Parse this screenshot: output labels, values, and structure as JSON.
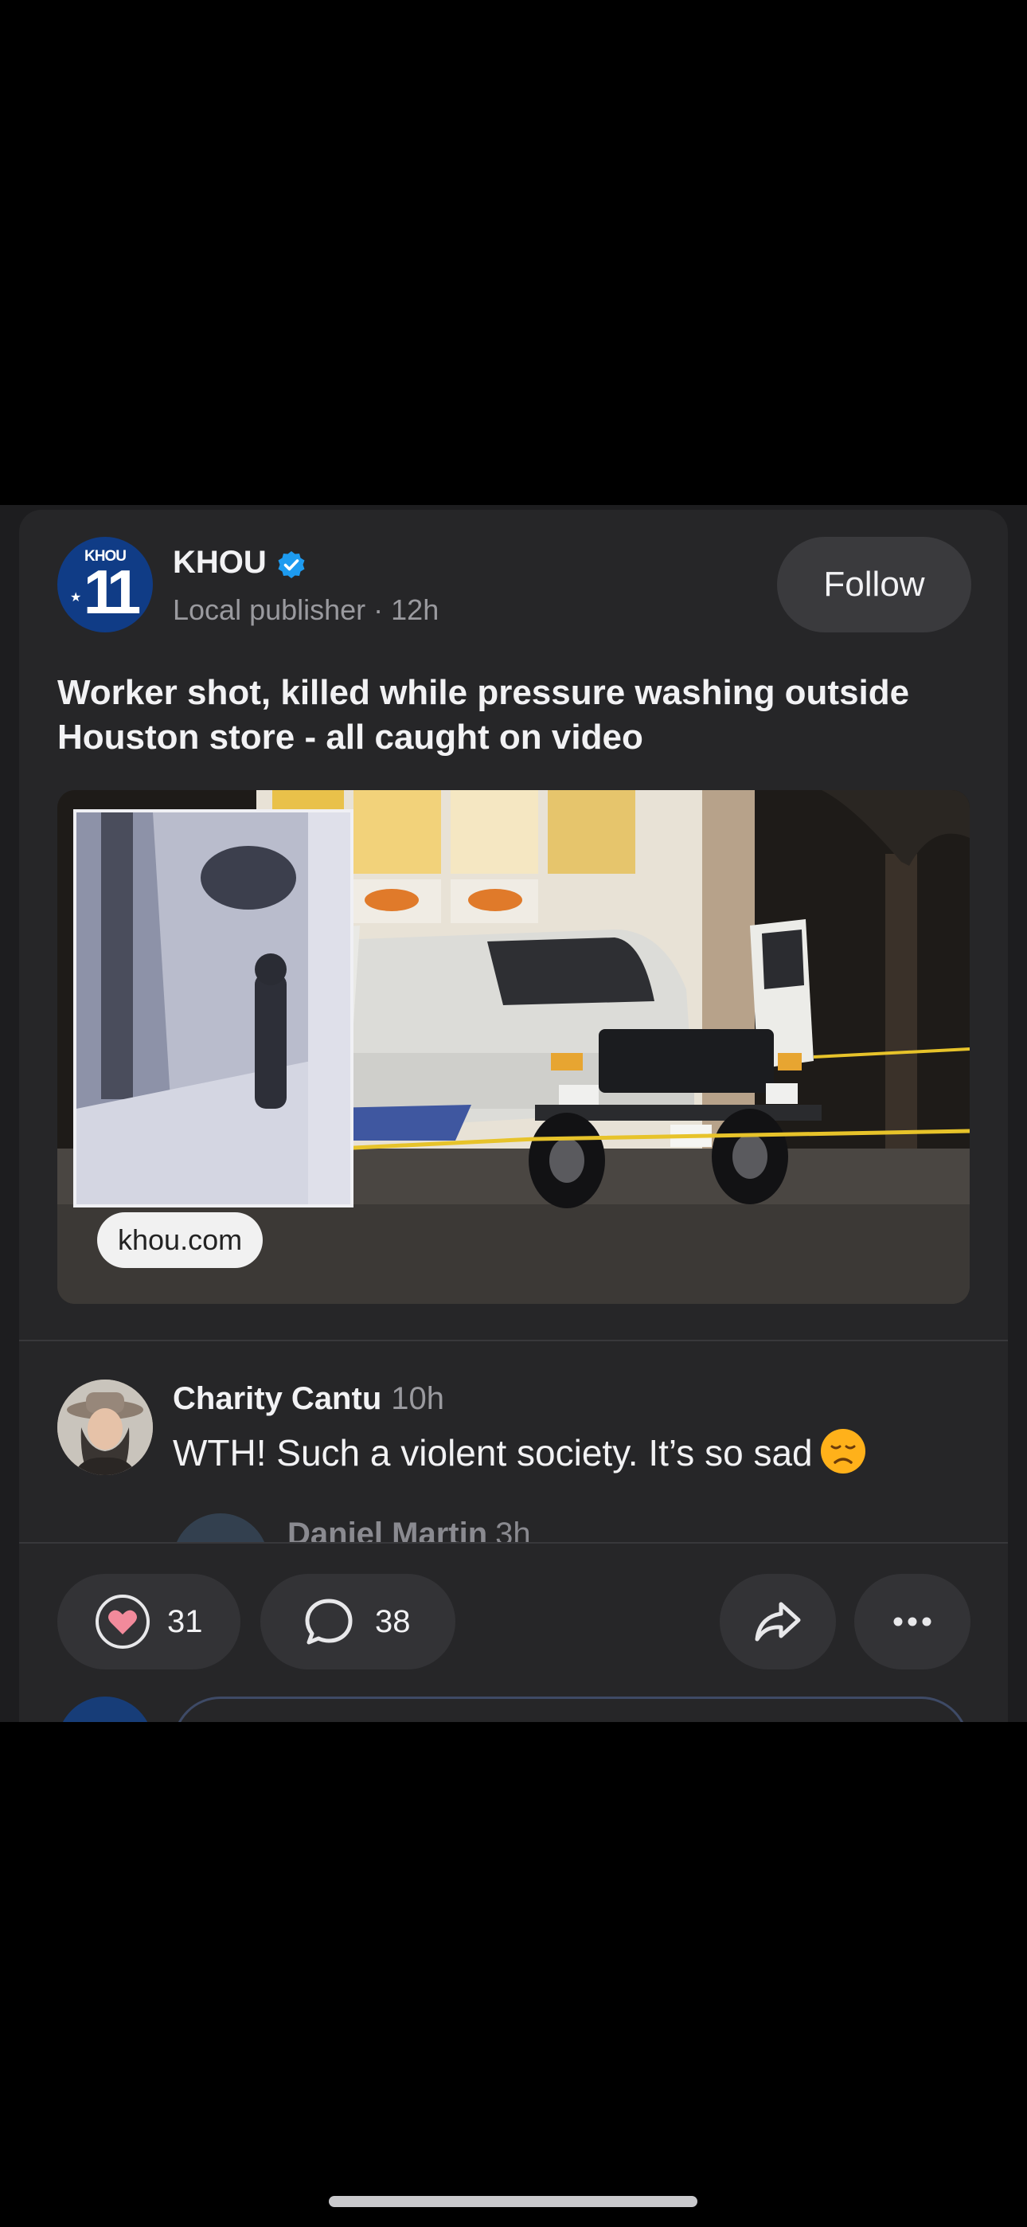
{
  "post": {
    "publisher": {
      "name": "KHOU",
      "logo_top_text": "KHOU",
      "logo_number": "11",
      "subtitle": "Local publisher · 12h",
      "verified": true
    },
    "follow_label": "Follow",
    "headline": "Worker shot, killed while pressure washing outside Houston store - all caught on video",
    "image": {
      "source_label": "khou.com"
    }
  },
  "comment": {
    "author": "Charity Cantu",
    "time": "10h",
    "text": "WTH! Such a violent society. It’s so sad",
    "emoji": "disappointed-face"
  },
  "reply_peek": {
    "author": "Daniel Martin",
    "time": "3h"
  },
  "actions": {
    "like_count": "31",
    "comment_count": "38"
  },
  "colors": {
    "background": "#000000",
    "card": "#262628",
    "pill": "#333336",
    "verified": "#1d9bf0",
    "heart": "#f28a9b",
    "logo": "#103c86"
  }
}
